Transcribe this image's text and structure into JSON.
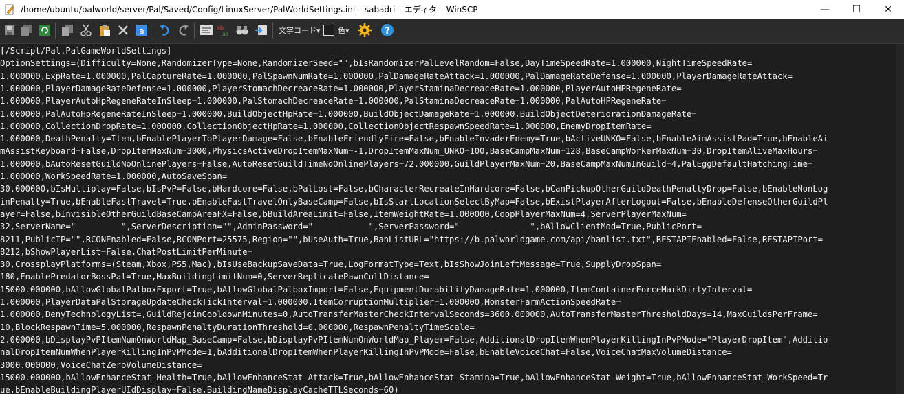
{
  "window": {
    "title": "/home/ubuntu/palworld/server/Pal/Saved/Config/LinuxServer/PalWorldSettings.ini – sabadri – エディタ – WinSCP",
    "minimize": "—",
    "maximize": "☐",
    "close": "✕"
  },
  "toolbar": {
    "encoding_label": "文字コード",
    "color_label": "色",
    "dropdown_arrow": "▾"
  },
  "colors": {
    "editor_bg": "#1e1e1e",
    "toolbar_bg": "#2b2b2b",
    "text": "#f0f0f0",
    "accent_blue": "#3c8ee8",
    "gear_orange": "#f2b31b"
  },
  "editor": {
    "lines": [
      "[/Script/Pal.PalGameWorldSettings]",
      "OptionSettings=(Difficulty=None,RandomizerType=None,RandomizerSeed=\"\",bIsRandomizerPalLevelRandom=False,DayTimeSpeedRate=1.000000,NightTimeSpeedRate=",
      "1.000000,ExpRate=1.000000,PalCaptureRate=1.000000,PalSpawnNumRate=1.000000,PalDamageRateAttack=1.000000,PalDamageRateDefense=1.000000,PlayerDamageRateAttack=",
      "1.000000,PlayerDamageRateDefense=1.000000,PlayerStomachDecreaceRate=1.000000,PlayerStaminaDecreaceRate=1.000000,PlayerAutoHPRegeneRate=",
      "1.000000,PlayerAutoHpRegeneRateInSleep=1.000000,PalStomachDecreaceRate=1.000000,PalStaminaDecreaceRate=1.000000,PalAutoHPRegeneRate=",
      "1.000000,PalAutoHpRegeneRateInSleep=1.000000,BuildObjectHpRate=1.000000,BuildObjectDamageRate=1.000000,BuildObjectDeteriorationDamageRate=",
      "1.000000,CollectionDropRate=1.000000,CollectionObjectHpRate=1.000000,CollectionObjectRespawnSpeedRate=1.000000,EnemyDropItemRate=",
      "1.000000,DeathPenalty=Item,bEnablePlayerToPlayerDamage=False,bEnableFriendlyFire=False,bEnableInvaderEnemy=True,bActiveUNKO=False,bEnableAimAssistPad=True,bEnableAi",
      "mAssistKeyboard=False,DropItemMaxNum=3000,PhysicsActiveDropItemMaxNum=-1,DropItemMaxNum_UNKO=100,BaseCampMaxNum=128,BaseCampWorkerMaxNum=30,DropItemAliveMaxHours=",
      "1.000000,bAutoResetGuildNoOnlinePlayers=False,AutoResetGuildTimeNoOnlinePlayers=72.000000,GuildPlayerMaxNum=20,BaseCampMaxNumInGuild=4,PalEggDefaultHatchingTime=",
      "1.000000,WorkSpeedRate=1.000000,AutoSaveSpan=",
      "30.000000,bIsMultiplay=False,bIsPvP=False,bHardcore=False,bPalLost=False,bCharacterRecreateInHardcore=False,bCanPickupOtherGuildDeathPenaltyDrop=False,bEnableNonLog",
      "inPenalty=True,bEnableFastTravel=True,bEnableFastTravelOnlyBaseCamp=False,bIsStartLocationSelectByMap=False,bExistPlayerAfterLogout=False,bEnableDefenseOtherGuildPl",
      "ayer=False,bInvisibleOtherGuildBaseCampAreaFX=False,bBuildAreaLimit=False,ItemWeightRate=1.000000,CoopPlayerMaxNum=4,ServerPlayerMaxNum=",
      "32,ServerName=\"         \",ServerDescription=\"\",AdminPassword=\"           \",ServerPassword=\"              \",bAllowClientMod=True,PublicPort=",
      "8211,PublicIP=\"\",RCONEnabled=False,RCONPort=25575,Region=\"\",bUseAuth=True,BanListURL=\"https://b.palworldgame.com/api/banlist.txt\",RESTAPIEnabled=False,RESTAPIPort=",
      "8212,bShowPlayerList=False,ChatPostLimitPerMinute=",
      "30,CrossplayPlatforms=(Steam,Xbox,PS5,Mac),bIsUseBackupSaveData=True,LogFormatType=Text,bIsShowJoinLeftMessage=True,SupplyDropSpan=",
      "180,EnablePredatorBossPal=True,MaxBuildingLimitNum=0,ServerReplicatePawnCullDistance=",
      "15000.000000,bAllowGlobalPalboxExport=True,bAllowGlobalPalboxImport=False,EquipmentDurabilityDamageRate=1.000000,ItemContainerForceMarkDirtyInterval=",
      "1.000000,PlayerDataPalStorageUpdateCheckTickInterval=1.000000,ItemCorruptionMultiplier=1.000000,MonsterFarmActionSpeedRate=",
      "1.000000,DenyTechnologyList=,GuildRejoinCooldownMinutes=0,AutoTransferMasterCheckIntervalSeconds=3600.000000,AutoTransferMasterThresholdDays=14,MaxGuildsPerFrame=",
      "10,BlockRespawnTime=5.000000,RespawnPenaltyDurationThreshold=0.000000,RespawnPenaltyTimeScale=",
      "2.000000,bDisplayPvPItemNumOnWorldMap_BaseCamp=False,bDisplayPvPItemNumOnWorldMap_Player=False,AdditionalDropItemWhenPlayerKillingInPvPMode=\"PlayerDropItem\",Additio",
      "nalDropItemNumWhenPlayerKillingInPvPMode=1,bAdditionalDropItemWhenPlayerKillingInPvPMode=False,bEnableVoiceChat=False,VoiceChatMaxVolumeDistance=",
      "3000.000000,VoiceChatZeroVolumeDistance=",
      "15000.000000,bAllowEnhanceStat_Health=True,bAllowEnhanceStat_Attack=True,bAllowEnhanceStat_Stamina=True,bAllowEnhanceStat_Weight=True,bAllowEnhanceStat_WorkSpeed=Tr",
      "ue,bEnableBuildingPlayerUIdDisplay=False,BuildingNameDisplayCacheTTLSeconds=60)"
    ]
  }
}
